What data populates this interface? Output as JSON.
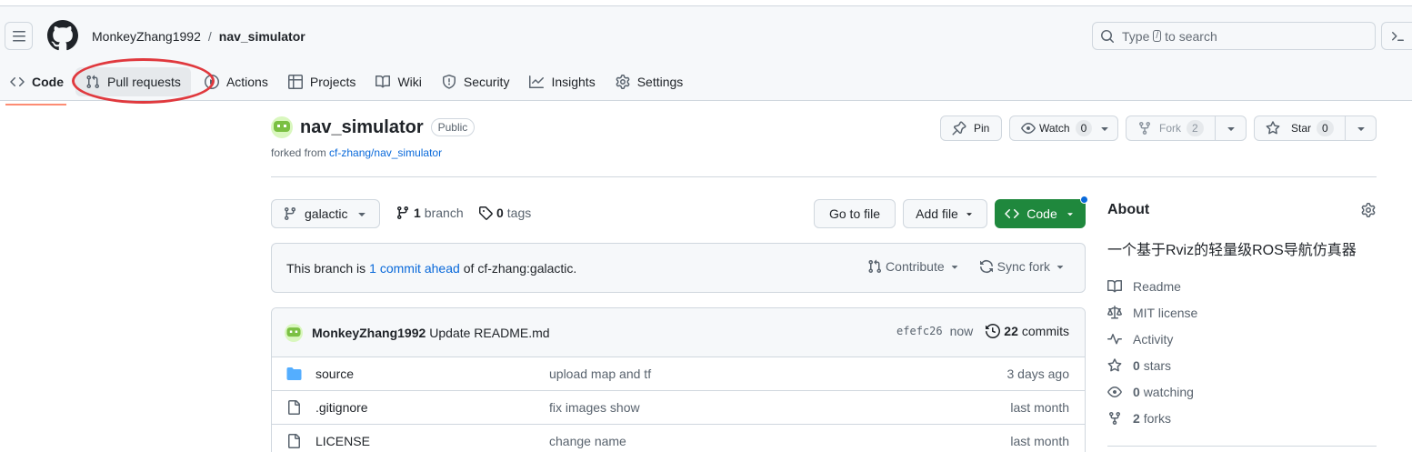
{
  "header": {
    "owner": "MonkeyZhang1992",
    "separator": "/",
    "repo": "nav_simulator",
    "search_prefix": "Type",
    "search_key": "/",
    "search_suffix": "to search"
  },
  "tabs": [
    {
      "label": "Code",
      "icon": "code-icon"
    },
    {
      "label": "Pull requests",
      "icon": "pull-request-icon"
    },
    {
      "label": "Actions",
      "icon": "play-icon"
    },
    {
      "label": "Projects",
      "icon": "table-icon"
    },
    {
      "label": "Wiki",
      "icon": "book-icon"
    },
    {
      "label": "Security",
      "icon": "shield-icon"
    },
    {
      "label": "Insights",
      "icon": "graph-icon"
    },
    {
      "label": "Settings",
      "icon": "gear-icon"
    }
  ],
  "repo": {
    "name": "nav_simulator",
    "visibility": "Public",
    "forked_prefix": "forked from",
    "forked_from": "cf-zhang/nav_simulator",
    "pin_label": "Pin",
    "watch_label": "Watch",
    "watch_count": "0",
    "fork_label": "Fork",
    "fork_count": "2",
    "star_label": "Star",
    "star_count": "0"
  },
  "filenav": {
    "branch": "galactic",
    "branch_count": "1",
    "branch_label": "branch",
    "tag_count": "0",
    "tag_label": "tags",
    "goto_file": "Go to file",
    "add_file": "Add file",
    "code": "Code"
  },
  "fork_status": {
    "prefix": "This branch is",
    "link": "1 commit ahead",
    "suffix": "of cf-zhang:galactic.",
    "contribute": "Contribute",
    "sync": "Sync fork"
  },
  "latest_commit": {
    "author": "MonkeyZhang1992",
    "message": "Update README.md",
    "sha": "efefc26",
    "time": "now",
    "count": "22",
    "count_label": "commits"
  },
  "files": [
    {
      "type": "folder",
      "name": "source",
      "message": "upload map and tf",
      "date": "3 days ago"
    },
    {
      "type": "file",
      "name": ".gitignore",
      "message": "fix images show",
      "date": "last month"
    },
    {
      "type": "file",
      "name": "LICENSE",
      "message": "change name",
      "date": "last month"
    }
  ],
  "about": {
    "title": "About",
    "description": "一个基于Rviz的轻量级ROS导航仿真器",
    "items": [
      {
        "icon": "book-icon",
        "label": "Readme",
        "count": ""
      },
      {
        "icon": "law-icon",
        "label": "MIT license",
        "count": ""
      },
      {
        "icon": "pulse-icon",
        "label": "Activity",
        "count": ""
      },
      {
        "icon": "star-icon",
        "label": "stars",
        "count": "0"
      },
      {
        "icon": "eye-icon",
        "label": "watching",
        "count": "0"
      },
      {
        "icon": "fork-icon",
        "label": "forks",
        "count": "2"
      }
    ]
  },
  "colors": {
    "accent": "#0969da",
    "primary_button": "#1f883d",
    "tab_underline": "#fd8c73",
    "annotation": "#e0393e"
  }
}
